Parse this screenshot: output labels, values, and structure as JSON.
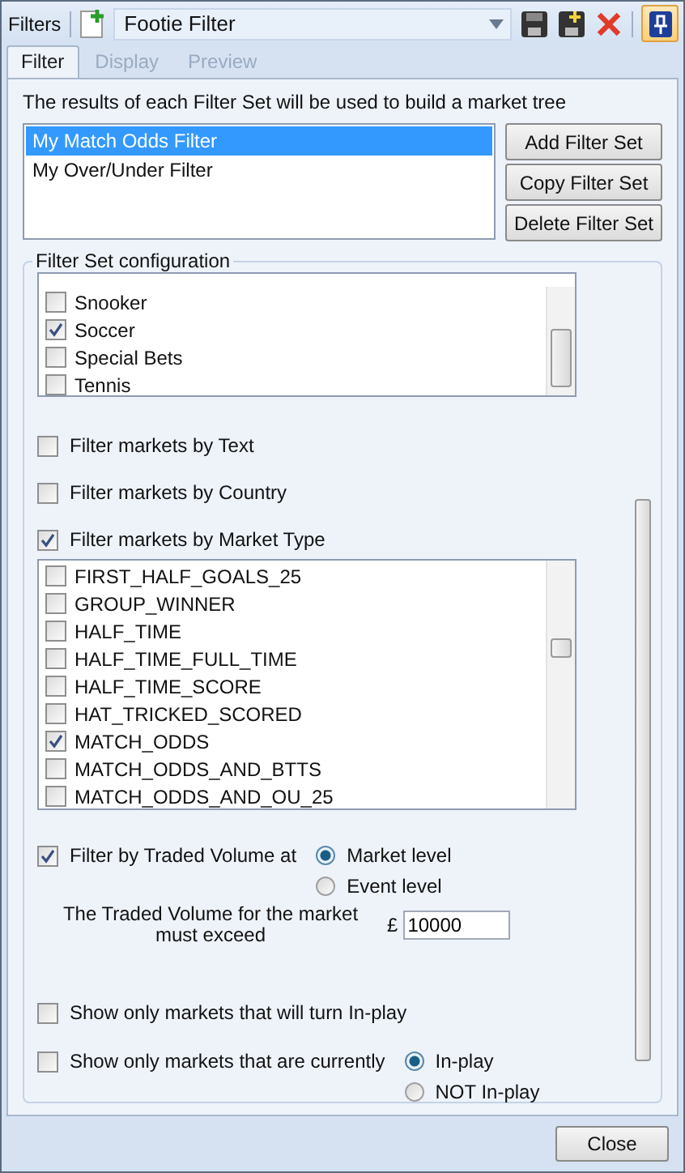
{
  "toolbar": {
    "label": "Filters",
    "filter_name": "Footie Filter"
  },
  "tabs": [
    {
      "label": "Filter",
      "selected": true
    },
    {
      "label": "Display",
      "selected": false
    },
    {
      "label": "Preview",
      "selected": false
    }
  ],
  "intro": "The results of each Filter Set will be used to build a market tree",
  "filter_sets": [
    {
      "name": "My Match Odds Filter",
      "selected": true
    },
    {
      "name": "My Over/Under Filter",
      "selected": false
    }
  ],
  "filter_set_buttons": [
    "Add Filter Set",
    "Copy Filter Set",
    "Delete Filter Set"
  ],
  "config": {
    "title": "Filter Set configuration",
    "sports": [
      {
        "name": "Snooker",
        "checked": false
      },
      {
        "name": "Soccer",
        "checked": true
      },
      {
        "name": "Special Bets",
        "checked": false
      },
      {
        "name": "Tennis",
        "checked": false
      }
    ],
    "text_filter": {
      "label": "Filter markets by Text",
      "checked": false
    },
    "country_filter": {
      "label": "Filter markets by Country",
      "checked": false
    },
    "market_type_filter": {
      "label": "Filter markets by Market Type",
      "checked": true,
      "market_types": [
        {
          "name": "FIRST_HALF_GOALS_25",
          "checked": false
        },
        {
          "name": "GROUP_WINNER",
          "checked": false
        },
        {
          "name": "HALF_TIME",
          "checked": false
        },
        {
          "name": "HALF_TIME_FULL_TIME",
          "checked": false
        },
        {
          "name": "HALF_TIME_SCORE",
          "checked": false
        },
        {
          "name": "HAT_TRICKED_SCORED",
          "checked": false
        },
        {
          "name": "MATCH_ODDS",
          "checked": true
        },
        {
          "name": "MATCH_ODDS_AND_BTTS",
          "checked": false
        },
        {
          "name": "MATCH_ODDS_AND_OU_25",
          "checked": false
        }
      ]
    },
    "traded_volume": {
      "label": "Filter by Traded Volume at",
      "checked": true,
      "levels": [
        {
          "label": "Market level",
          "selected": true
        },
        {
          "label": "Event level",
          "selected": false
        }
      ],
      "threshold_label": "The Traded Volume for the market must exceed",
      "currency": "£",
      "value": "10000"
    },
    "will_turn_inplay": {
      "label": "Show only markets that will turn In-play",
      "checked": false
    },
    "currently_inplay": {
      "label": "Show only markets that are currently",
      "checked": false,
      "states": [
        {
          "label": "In-play",
          "selected": true
        },
        {
          "label": "NOT In-play",
          "selected": false
        }
      ]
    }
  },
  "close_button": "Close"
}
